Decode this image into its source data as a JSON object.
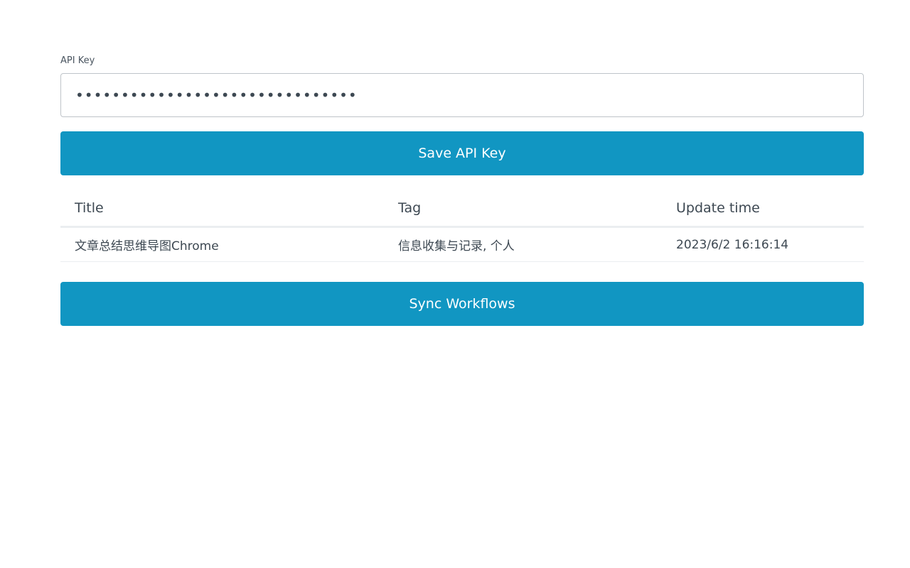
{
  "api_key": {
    "label": "API Key",
    "masked_value": "•••••••••••••••••••••••••••••••"
  },
  "save_button": {
    "label": "Save API Key"
  },
  "table": {
    "headers": [
      "Title",
      "Tag",
      "Update time"
    ],
    "rows": [
      {
        "title": "文章总结思维导图Chrome",
        "tag": "信息收集与记录, 个人",
        "update_time": "2023/6/2 16:16:14"
      }
    ]
  },
  "sync_button": {
    "label": "Sync Workflows"
  },
  "colors": {
    "primary": "#1196c2",
    "text": "#3d4852",
    "border": "#bfc4c9"
  }
}
